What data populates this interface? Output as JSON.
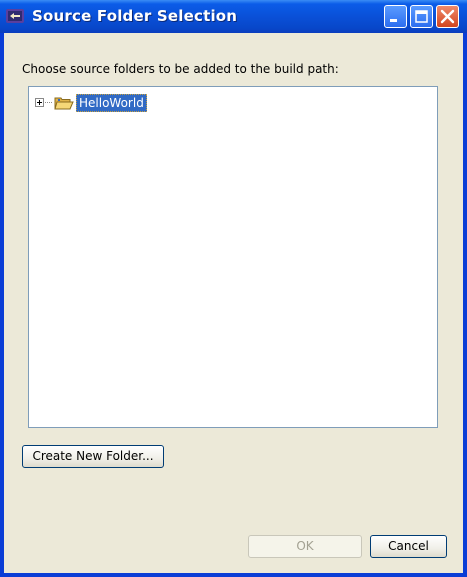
{
  "window": {
    "title": "Source Folder Selection",
    "controls": {
      "minimize": "minimize",
      "maximize": "maximize",
      "close": "close"
    }
  },
  "dialog": {
    "prompt": "Choose source folders to be added to the build path:",
    "tree": {
      "items": [
        {
          "label": "HelloWorld",
          "expanded": false,
          "selected": true,
          "icon": "open-folder-icon"
        }
      ]
    }
  },
  "buttons": {
    "create_new_folder": "Create New Folder...",
    "ok": "OK",
    "cancel": "Cancel",
    "ok_enabled": false
  },
  "colors": {
    "titlebar": "#0a50d8",
    "dialog_bg": "#ece9d8",
    "selection": "#316ac5",
    "close_button": "#d2451f"
  }
}
